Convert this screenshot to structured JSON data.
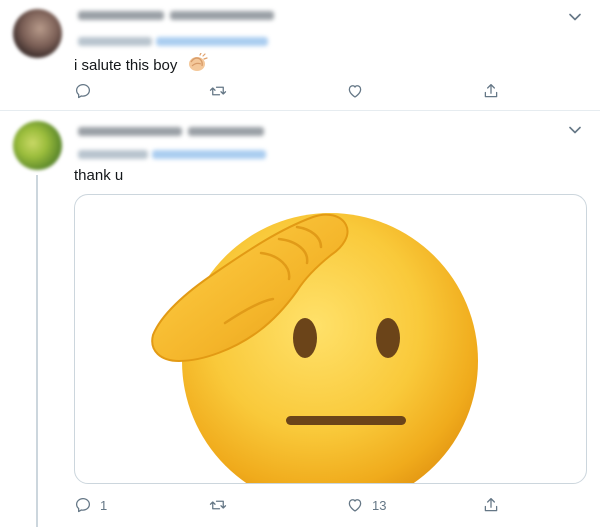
{
  "tweets": [
    {
      "text": "i salute this boy",
      "has_emoji": "clapping-hands",
      "actions": {
        "reply_count": "",
        "retweet_count": "",
        "like_count": ""
      }
    },
    {
      "text": "thank u",
      "media": "saluting-face-emoji",
      "actions": {
        "reply_count": "1",
        "retweet_count": "",
        "like_count": "13"
      }
    }
  ],
  "colors": {
    "icon": "#657786",
    "divider": "#e6ecf0",
    "thread_line": "#ccd6dd",
    "emoji_face": "#f7c53a",
    "emoji_hand": "#f2b01e"
  },
  "icons": [
    "reply-icon",
    "retweet-icon",
    "like-icon",
    "share-icon",
    "chevron-down-icon"
  ]
}
